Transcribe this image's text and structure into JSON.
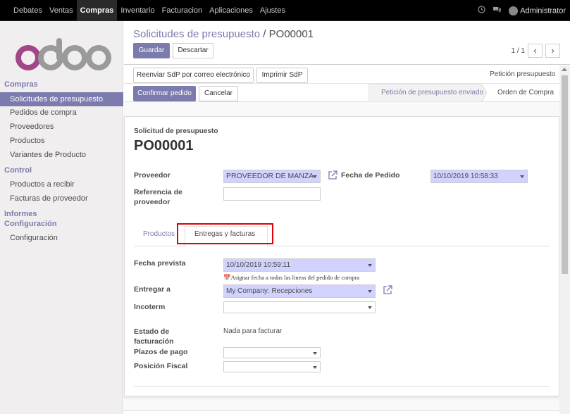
{
  "topbar": {
    "menu": [
      "Debates",
      "Ventas",
      "Compras",
      "Inventario",
      "Facturacion",
      "Aplicaciones",
      "Ajustes"
    ],
    "user": "Administrator"
  },
  "sidebar": {
    "section_compras": "Compras",
    "items_compras": [
      "Solicitudes de presupuesto",
      "Pedidos de compra",
      "Proveedores",
      "Productos",
      "Variantes de Producto"
    ],
    "section_control": "Control",
    "items_control": [
      "Productos a recibir",
      "Facturas de proveedor"
    ],
    "section_informes": "Informes",
    "section_configuracion": "Configuración",
    "items_config": [
      "Configuración"
    ]
  },
  "breadcrumb": {
    "parent": "Solicitudes de presupuesto",
    "separator": " / ",
    "current": "PO00001"
  },
  "buttons": {
    "save": "Guardar",
    "discard": "Descartar",
    "resend": "Reenviar SdP por correo electrónico",
    "print": "Imprimir SdP",
    "confirm": "Confirmar pedido",
    "cancel": "Cancelar"
  },
  "pager": {
    "value": "1 / 1",
    "prev": "‹",
    "next": "›"
  },
  "status": {
    "stage1": "Petición presupuesto",
    "stage2": "Petición de presupuesto enviado",
    "stage3": "Orden de Compra"
  },
  "form": {
    "doc_type": "Solicitud de presupuesto",
    "doc_name": "PO00001",
    "proveedor_label": "Proveedor",
    "proveedor_value": "PROVEEDOR DE MANZA",
    "fecha_pedido_label": "Fecha de Pedido",
    "fecha_pedido_value": "10/10/2019 10:58:33",
    "ref_label_1": "Referencia de",
    "ref_label_2": "proveedor",
    "tabs": [
      "Productos",
      "Entregas y facturas"
    ],
    "fecha_prevista_label": "Fecha prevista",
    "fecha_prevista_value": "10/10/2019 10:59:11",
    "assign_link": "Asignar fecha a todas las lineas del pedido de compra",
    "entregar_label": "Entregar a",
    "entregar_value": "My Company: Recepciones",
    "incoterm_label": "Incoterm",
    "estado_label_1": "Estado de",
    "estado_label_2": "facturación",
    "estado_value": "Nada para facturar",
    "plazos_label": "Plazos de pago",
    "posicion_label": "Posición Fiscal"
  },
  "colors": {
    "accent": "#7c7bad",
    "required": "#d2d2ff",
    "highlight": "#e00000"
  }
}
